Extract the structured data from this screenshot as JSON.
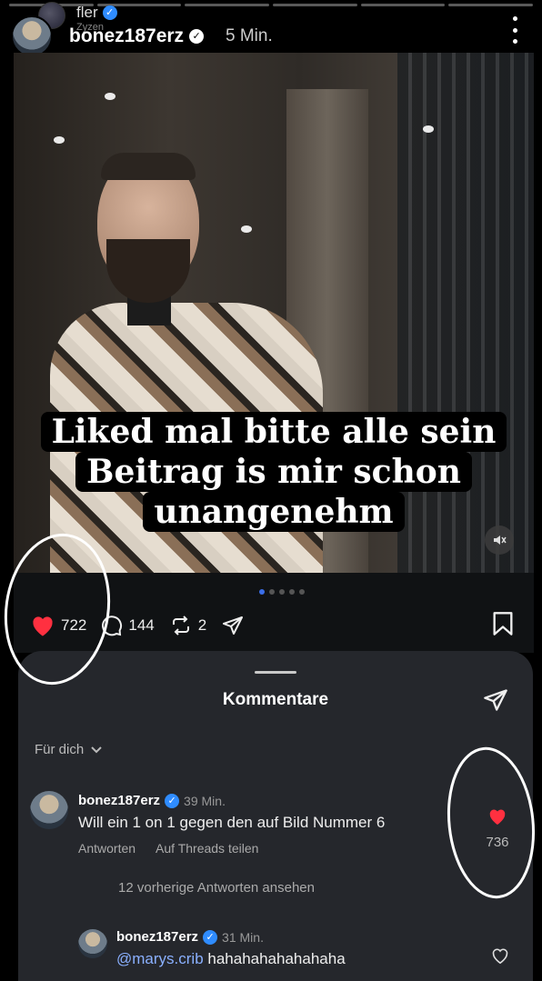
{
  "story": {
    "segments_total": 6,
    "segments_done": 0
  },
  "reposter": {
    "name": "fler",
    "sub": "Zyzen"
  },
  "post": {
    "username": "bonez187erz",
    "time": "5 Min.",
    "overlay_lines": [
      "Liked mal bitte alle sein",
      "Beitrag is mir schon",
      "unangenehm"
    ],
    "carousel_dots": 5,
    "carousel_active": 0,
    "likes": "722",
    "comments": "144",
    "reposts": "2"
  },
  "comments_sheet": {
    "title": "Kommentare",
    "filter": "Für dich",
    "comments": [
      {
        "user": "bonez187erz",
        "time": "39 Min.",
        "text": "Will ein 1 on 1 gegen den auf Bild Nummer 6",
        "reply": "Antworten",
        "share": "Auf Threads teilen",
        "likes": "736"
      }
    ],
    "more_replies": "12 vorherige Antworten ansehen",
    "reply": {
      "user": "bonez187erz",
      "time": "31 Min.",
      "mention": "@marys.crib",
      "text": " hahahahahahahaha"
    }
  },
  "colors": {
    "accent_blue": "#2f8cff",
    "like_red": "#ff3040",
    "sheet_bg": "#25272c"
  }
}
